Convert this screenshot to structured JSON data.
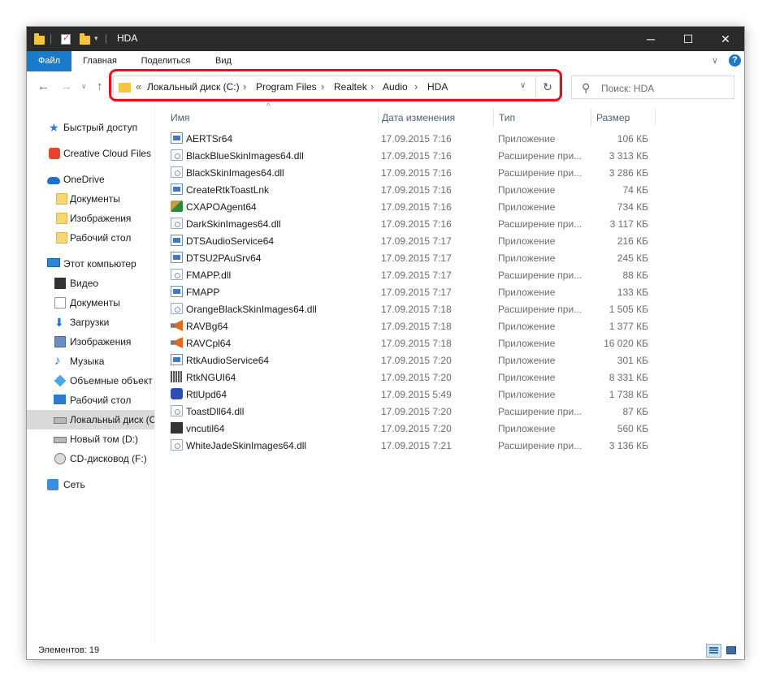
{
  "window": {
    "title": "HDA",
    "minimize_glyph": "─",
    "maximize_glyph": "☐",
    "close_glyph": "✕"
  },
  "ribbon": {
    "tabs": [
      "Файл",
      "Главная",
      "Поделиться",
      "Вид"
    ],
    "expand_glyph": "∨",
    "help_glyph": "?"
  },
  "nav": {
    "back_glyph": "←",
    "forward_glyph": "→",
    "recent_glyph": "∨",
    "up_glyph": "↑",
    "overflow_glyph": "«",
    "breadcrumb": [
      "Локальный диск (C:)",
      "Program Files",
      "Realtek",
      "Audio",
      "HDA"
    ],
    "crumb_separator": "›",
    "dropdown_glyph": "∨",
    "refresh_glyph": "↻",
    "search_placeholder": "Поиск: HDA",
    "search_glyph": "⚲"
  },
  "sidebar": {
    "quick_access": "Быстрый доступ",
    "creative_cloud": "Creative Cloud Files",
    "onedrive": "OneDrive",
    "onedrive_items": [
      "Документы",
      "Изображения",
      "Рабочий стол"
    ],
    "this_pc": "Этот компьютер",
    "pc_items": [
      "Видео",
      "Документы",
      "Загрузки",
      "Изображения",
      "Музыка",
      "Объемные объект",
      "Рабочий стол",
      "Локальный диск (C",
      "Новый том (D:)",
      "CD-дисковод (F:)"
    ],
    "network": "Сеть",
    "expand_glyph": "›"
  },
  "columns": {
    "name": "Имя",
    "date": "Дата изменения",
    "type": "Тип",
    "size": "Размер",
    "sort_glyph": "^"
  },
  "files": [
    {
      "name": "AERTSr64",
      "date": "17.09.2015 7:16",
      "type": "Приложение",
      "size": "106 КБ",
      "icon": "exe-icon"
    },
    {
      "name": "BlackBlueSkinImages64.dll",
      "date": "17.09.2015 7:16",
      "type": "Расширение при...",
      "size": "3 313 КБ",
      "icon": "dll-icon"
    },
    {
      "name": "BlackSkinImages64.dll",
      "date": "17.09.2015 7:16",
      "type": "Расширение при...",
      "size": "3 286 КБ",
      "icon": "dll-icon"
    },
    {
      "name": "CreateRtkToastLnk",
      "date": "17.09.2015 7:16",
      "type": "Приложение",
      "size": "74 КБ",
      "icon": "exe-icon"
    },
    {
      "name": "CXAPOAgent64",
      "date": "17.09.2015 7:16",
      "type": "Приложение",
      "size": "734 КБ",
      "icon": "tools-icon"
    },
    {
      "name": "DarkSkinImages64.dll",
      "date": "17.09.2015 7:16",
      "type": "Расширение при...",
      "size": "3 117 КБ",
      "icon": "dll-icon"
    },
    {
      "name": "DTSAudioService64",
      "date": "17.09.2015 7:17",
      "type": "Приложение",
      "size": "216 КБ",
      "icon": "exe-icon"
    },
    {
      "name": "DTSU2PAuSrv64",
      "date": "17.09.2015 7:17",
      "type": "Приложение",
      "size": "245 КБ",
      "icon": "exe-icon"
    },
    {
      "name": "FMAPP.dll",
      "date": "17.09.2015 7:17",
      "type": "Расширение при...",
      "size": "88 КБ",
      "icon": "dll-icon"
    },
    {
      "name": "FMAPP",
      "date": "17.09.2015 7:17",
      "type": "Приложение",
      "size": "133 КБ",
      "icon": "exe-icon"
    },
    {
      "name": "OrangeBlackSkinImages64.dll",
      "date": "17.09.2015 7:18",
      "type": "Расширение при...",
      "size": "1 505 КБ",
      "icon": "dll-icon"
    },
    {
      "name": "RAVBg64",
      "date": "17.09.2015 7:18",
      "type": "Приложение",
      "size": "1 377 КБ",
      "icon": "speaker-icon"
    },
    {
      "name": "RAVCpl64",
      "date": "17.09.2015 7:18",
      "type": "Приложение",
      "size": "16 020 КБ",
      "icon": "speaker-icon"
    },
    {
      "name": "RtkAudioService64",
      "date": "17.09.2015 7:20",
      "type": "Приложение",
      "size": "301 КБ",
      "icon": "exe-icon"
    },
    {
      "name": "RtkNGUI64",
      "date": "17.09.2015 7:20",
      "type": "Приложение",
      "size": "8 331 КБ",
      "icon": "equalizer-icon"
    },
    {
      "name": "RtlUpd64",
      "date": "17.09.2015 5:49",
      "type": "Приложение",
      "size": "1 738 КБ",
      "icon": "updater-icon"
    },
    {
      "name": "ToastDll64.dll",
      "date": "17.09.2015 7:20",
      "type": "Расширение при...",
      "size": "87 КБ",
      "icon": "dll-icon"
    },
    {
      "name": "vncutil64",
      "date": "17.09.2015 7:20",
      "type": "Приложение",
      "size": "560 КБ",
      "icon": "vnc-icon"
    },
    {
      "name": "WhiteJadeSkinImages64.dll",
      "date": "17.09.2015 7:21",
      "type": "Расширение при...",
      "size": "3 136 КБ",
      "icon": "dll-icon"
    }
  ],
  "status": {
    "items_count": "Элементов: 19"
  },
  "colors": {
    "titlebar": "#2b2b2b",
    "accent": "#1979ca",
    "highlight": "#e5101a",
    "selected_nav": "#d9d9d9"
  }
}
